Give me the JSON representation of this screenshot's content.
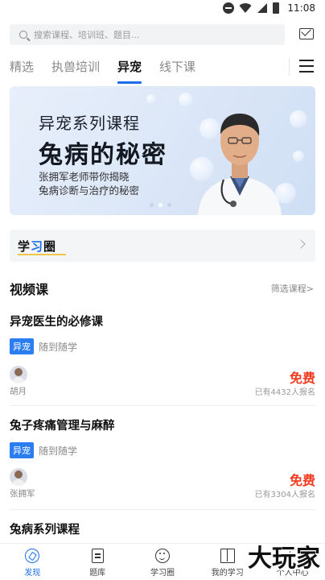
{
  "status_bar": {
    "time": "11:08",
    "icons": [
      "do-not-disturb-icon",
      "wifi-icon",
      "signal-icon",
      "battery-icon"
    ]
  },
  "search": {
    "placeholder": "搜索课程、培训班、题目..."
  },
  "header": {
    "message_icon": "message-icon"
  },
  "tabs": [
    {
      "label": "精选",
      "active": false
    },
    {
      "label": "执兽培训",
      "active": false
    },
    {
      "label": "异宠",
      "active": true
    },
    {
      "label": "线下课",
      "active": false
    }
  ],
  "banner": {
    "title": "异宠系列课程",
    "headline": "兔病的秘密",
    "desc_line1": "张拥军老师带你揭晓",
    "desc_line2": "兔病诊断与治疗的秘密",
    "dots": 3,
    "active_dot": 1
  },
  "study_circle": {
    "label_part1": "学",
    "label_part2": "习",
    "label_part3": "圈"
  },
  "section": {
    "title": "视频课",
    "filter": "筛选课程>"
  },
  "courses": [
    {
      "title": "异宠医生的必修课",
      "tag": "异宠",
      "mode": "随到随学",
      "teacher": "胡月",
      "price": "免费",
      "enroll": "已有4432人报名"
    },
    {
      "title": "兔子疼痛管理与麻醉",
      "tag": "异宠",
      "mode": "随到随学",
      "teacher": "张拥军",
      "price": "免费",
      "enroll": "已有3304人报名"
    },
    {
      "title": "兔病系列课程"
    }
  ],
  "bottom_nav": [
    {
      "label": "发现",
      "icon": "compass-icon",
      "active": true
    },
    {
      "label": "题库",
      "icon": "document-icon",
      "active": false
    },
    {
      "label": "学习圈",
      "icon": "smile-icon",
      "active": false
    },
    {
      "label": "我的学习",
      "icon": "book-icon",
      "active": false
    },
    {
      "label": "个人中心",
      "icon": "person-icon",
      "active": false
    }
  ],
  "watermark": "大玩家",
  "colors": {
    "accent": "#1a6fe8",
    "price": "#f23a1f",
    "tag": "#2b7df2"
  }
}
